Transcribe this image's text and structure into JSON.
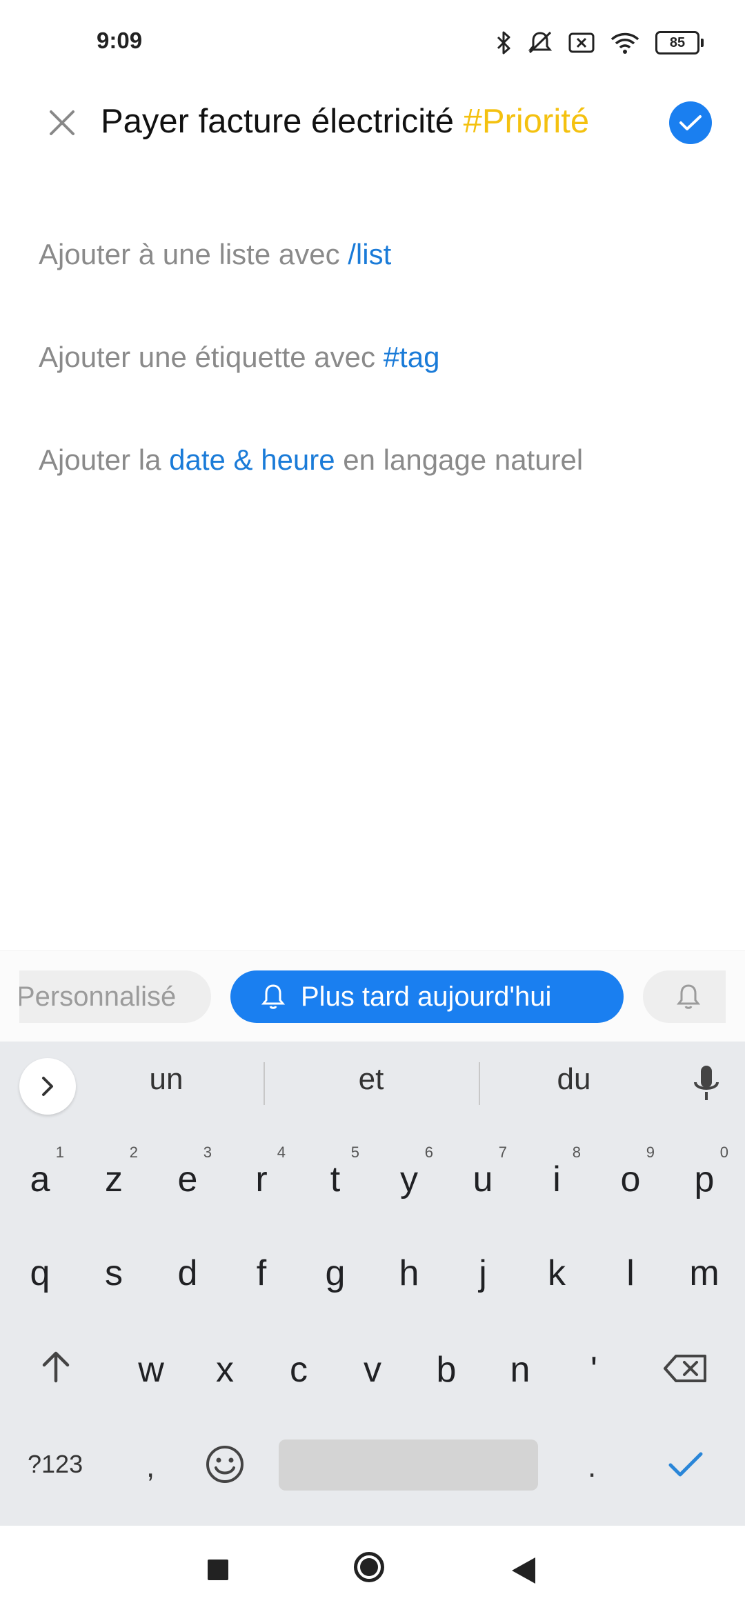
{
  "status_bar": {
    "time": "9:09",
    "battery": "85",
    "icons": [
      "bluetooth-icon",
      "silent-icon",
      "sim-x-icon",
      "wifi-icon",
      "battery-icon"
    ]
  },
  "header": {
    "close_icon": "close-icon",
    "title_text": "Payer facture électricité ",
    "title_tag": "#Priorité",
    "confirm_icon": "check-icon"
  },
  "hints": {
    "list": {
      "prefix": "Ajouter à une liste avec ",
      "highlight": "/list"
    },
    "tag": {
      "prefix": "Ajouter une étiquette avec ",
      "highlight": "#tag"
    },
    "date": {
      "prefix": "Ajouter la ",
      "highlight": "date & heure",
      "suffix": " en langage naturel"
    }
  },
  "quick_chips": [
    {
      "label": "Personnalisé"
    },
    {
      "label": "Plus tard aujourd'hui",
      "icon": "bell-icon"
    },
    {
      "label": "",
      "icon": "bell-icon"
    }
  ],
  "keyboard": {
    "suggestions": [
      "un",
      "et",
      "du"
    ],
    "row1": [
      {
        "k": "a",
        "n": "1"
      },
      {
        "k": "z",
        "n": "2"
      },
      {
        "k": "e",
        "n": "3"
      },
      {
        "k": "r",
        "n": "4"
      },
      {
        "k": "t",
        "n": "5"
      },
      {
        "k": "y",
        "n": "6"
      },
      {
        "k": "u",
        "n": "7"
      },
      {
        "k": "i",
        "n": "8"
      },
      {
        "k": "o",
        "n": "9"
      },
      {
        "k": "p",
        "n": "0"
      }
    ],
    "row2": [
      "q",
      "s",
      "d",
      "f",
      "g",
      "h",
      "j",
      "k",
      "l",
      "m"
    ],
    "row3": [
      "w",
      "x",
      "c",
      "v",
      "b",
      "n",
      "'"
    ],
    "symbols_key": "?123",
    "comma_key": ",",
    "period_key": "."
  },
  "colors": {
    "accent": "#1a7ff0",
    "tag_yellow": "#f4c10f",
    "hint_highlight": "#1a7bd8",
    "hint_grey": "#8a8a8a"
  }
}
